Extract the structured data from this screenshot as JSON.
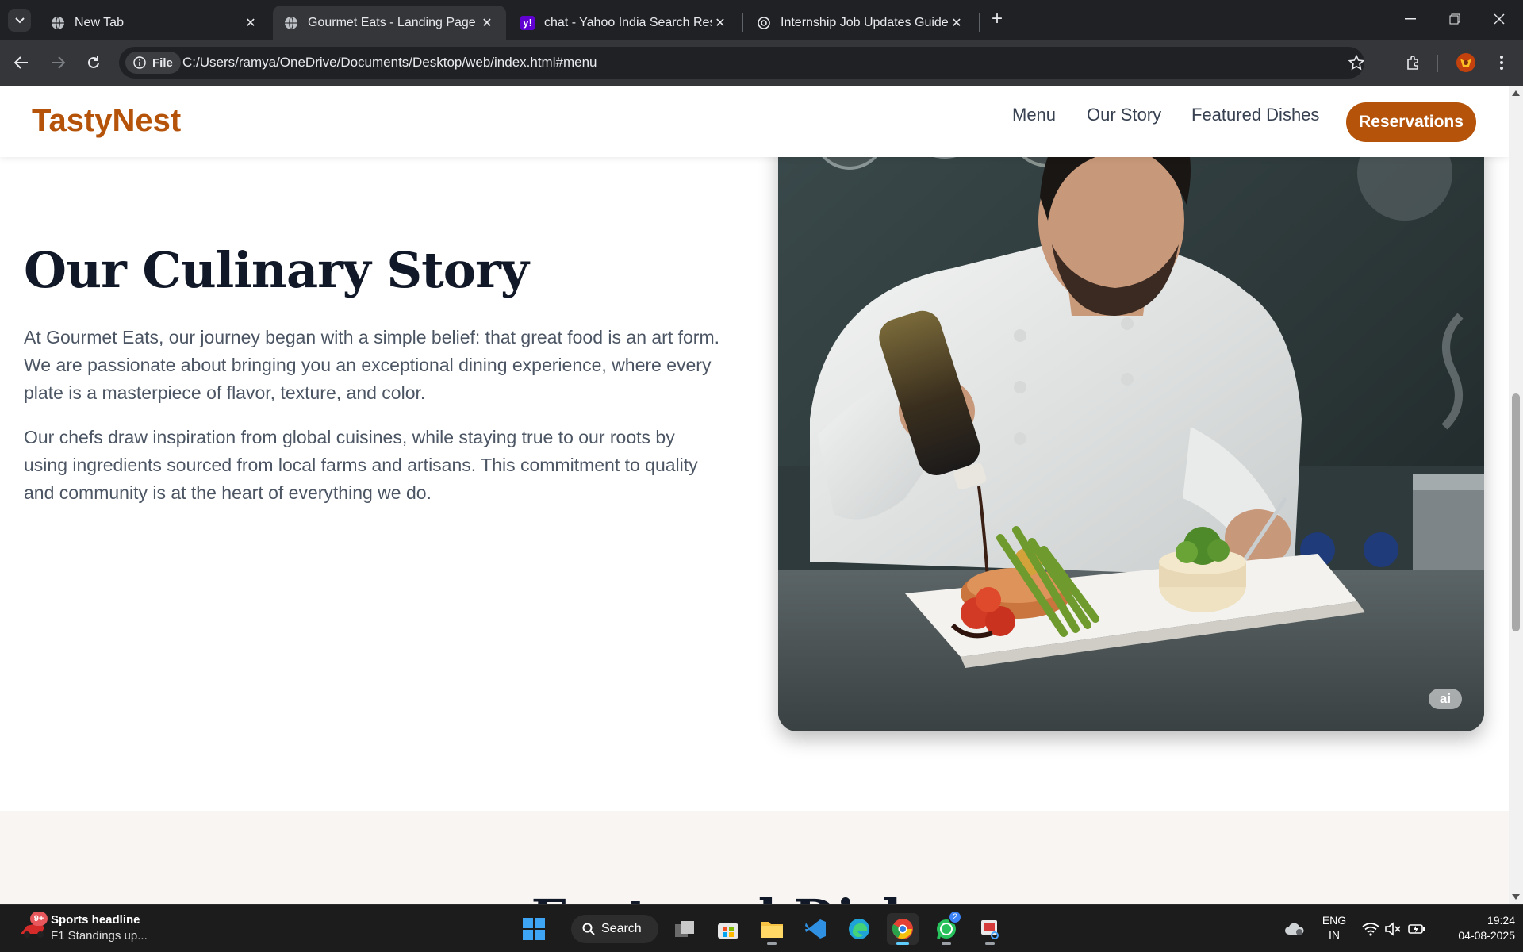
{
  "browser": {
    "tabs": [
      {
        "title": "New Tab",
        "icon": "globe-icon"
      },
      {
        "title": "Gourmet Eats - Landing Page",
        "icon": "globe-icon"
      },
      {
        "title": "chat - Yahoo India Search Results",
        "icon": "yahoo-icon"
      },
      {
        "title": "Internship Job Updates Guide",
        "icon": "openai-icon"
      }
    ],
    "active_tab": 1,
    "chip_label": "File",
    "url": "C:/Users/ramya/OneDrive/Documents/Desktop/web/index.html#menu"
  },
  "site": {
    "logo": "TastyNest",
    "nav": [
      "Menu",
      "Our Story",
      "Featured Dishes"
    ],
    "cta": "Reservations",
    "brand_color": "#b45309"
  },
  "story": {
    "heading": "Our Culinary Story",
    "paragraphs": [
      "At Gourmet Eats, our journey began with a simple belief: that great food is an art form. We are passionate about bringing you an exceptional dining experience, where every plate is a masterpiece of flavor, texture, and color.",
      "Our chefs draw inspiration from global cuisines, while staying true to our roots by using ingredients sourced from local farms and artisans. This commitment to quality and community is at the heart of everything we do."
    ],
    "image_badge": "ai"
  },
  "featured": {
    "heading": "Featured Dishes"
  },
  "taskbar": {
    "news_badge": "9+",
    "news_title": "Sports headline",
    "news_subtitle": "F1 Standings up...",
    "search_label": "Search",
    "whatsapp_badge": "2",
    "lang_line1": "ENG",
    "lang_line2": "IN",
    "time": "19:24",
    "date": "04-08-2025"
  }
}
